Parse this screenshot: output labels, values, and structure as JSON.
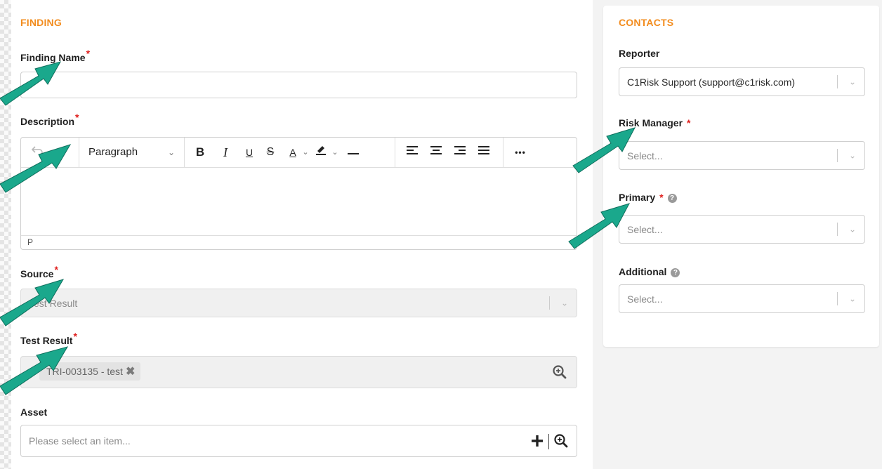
{
  "finding": {
    "section_title": "FINDING",
    "name_label": "Finding Name",
    "name_value": "",
    "description_label": "Description",
    "editor": {
      "paragraph_label": "Paragraph",
      "bold": "B",
      "italic": "I",
      "underline": "U",
      "strike": "S",
      "font_color": "A",
      "more": "•••",
      "status_path": "P"
    },
    "source_label": "Source",
    "source_value": "Test Result",
    "test_result_label": "Test Result",
    "test_result_chip": "TRI-003135 - test",
    "asset_label": "Asset",
    "asset_placeholder": "Please select an item..."
  },
  "contacts": {
    "section_title": "CONTACTS",
    "reporter_label": "Reporter",
    "reporter_value": "C1Risk Support (support@c1risk.com)",
    "risk_manager_label": "Risk Manager",
    "risk_manager_placeholder": "Select...",
    "primary_label": "Primary",
    "primary_placeholder": "Select...",
    "additional_label": "Additional",
    "additional_placeholder": "Select..."
  },
  "required_mark": "*",
  "help_glyph": "?",
  "colors": {
    "section_title": "#f28c1e",
    "required": "#e0201e",
    "annotation_arrow": "#1aa88c"
  },
  "icons": [
    "undo-icon",
    "redo-icon",
    "align-left-icon",
    "align-center-icon",
    "align-right-icon",
    "align-justify-icon",
    "zoom-icon",
    "plus-icon",
    "chevron-down-icon",
    "help-icon",
    "remove-icon",
    "annotation-arrow-icon"
  ]
}
